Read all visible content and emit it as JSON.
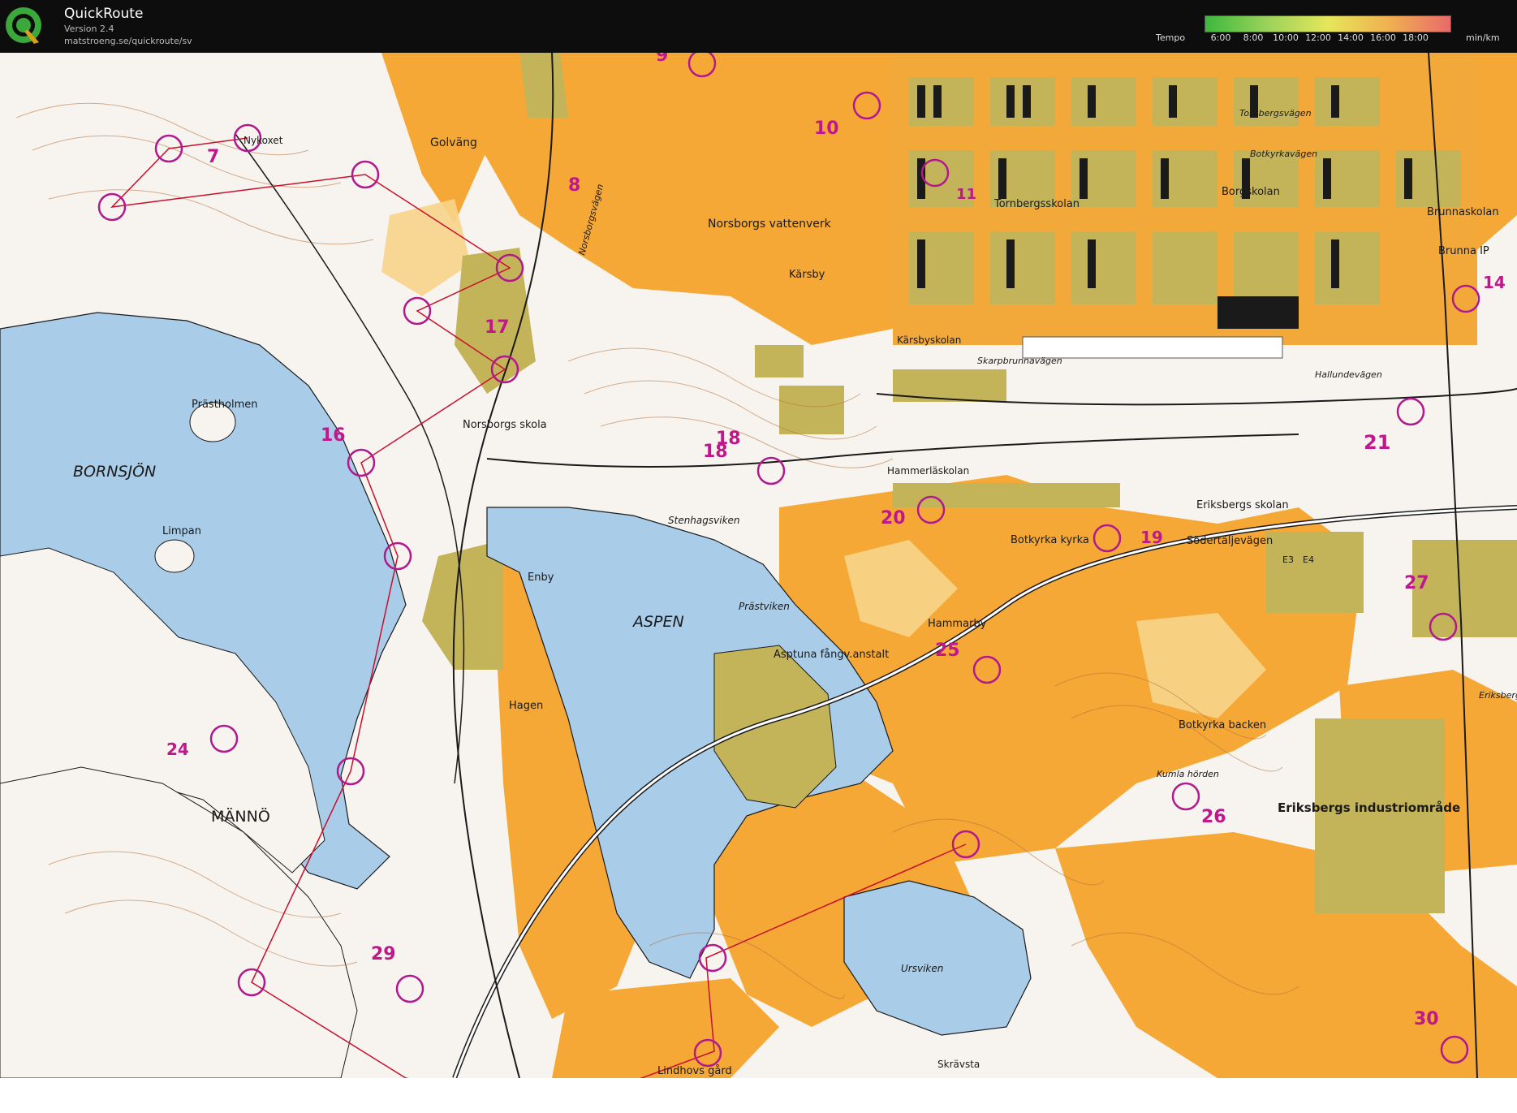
{
  "app": {
    "title": "QuickRoute",
    "version": "Version 2.4",
    "url": "matstroeng.se/quickroute/sv"
  },
  "tempo_legend": {
    "label": "Tempo",
    "ticks": [
      "6:00",
      "8:00",
      "10:00",
      "12:00",
      "14:00",
      "16:00",
      "18:00"
    ],
    "unit": "min/km",
    "gradient_colors": [
      "#3db83d",
      "#9ad25a",
      "#e6e65a",
      "#f0b050",
      "#e86a6a"
    ]
  },
  "colors": {
    "control_circle": "#b01a8e",
    "route_line": "#c8102e",
    "water": "#a9cce8",
    "open_land": "#f5a836",
    "rough_open": "#f7d48a",
    "settlement": "#c3b45a",
    "forest": "#f7f4ef",
    "contour": "#b5703a"
  },
  "map": {
    "place_names": [
      "Nykoxet",
      "Golväng",
      "Norsborgs vattenverk",
      "Kärsby",
      "Prästholmen",
      "Norsborgs skola",
      "BORNSJÖN",
      "Limpan",
      "Stenhagsviken",
      "Enby",
      "ASPEN",
      "Prästviken",
      "Asptuna fångv.anstalt",
      "Hagen",
      "MÄNNÖ",
      "Hammarby",
      "Hammerläskolan",
      "Botkyrka kyrka",
      "Eriksbergs skolan",
      "Södertäljevägen",
      "E3",
      "E4",
      "Botkyrka backen",
      "Kumla hörden",
      "Eriksbergs industriområde",
      "Ursviken",
      "Lindhovs gård",
      "Skrävsta",
      "Tornbergsskolan",
      "Borgskolan",
      "Brunnaskolan",
      "Brunna IP",
      "Kärsbyskolan",
      "Skarpbrunnavägen",
      "Hallundevägen",
      "Botkyrkavägen",
      "Tornbergsvägen",
      "Eriksberg",
      "Norsborgsvägen"
    ],
    "control_numbers": [
      "7",
      "8",
      "9",
      "10",
      "11",
      "14",
      "16",
      "17",
      "18",
      "18",
      "19",
      "20",
      "21",
      "24",
      "25",
      "26",
      "27",
      "29",
      "30"
    ]
  }
}
